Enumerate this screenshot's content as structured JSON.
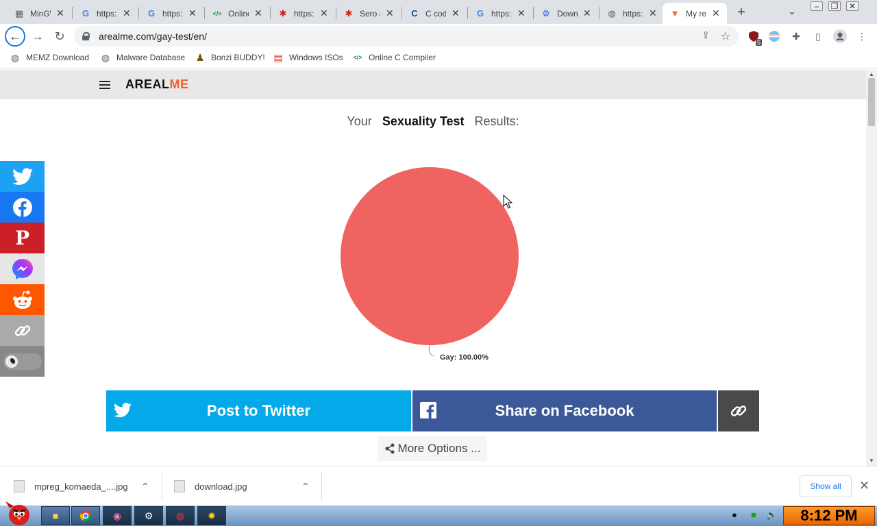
{
  "browser": {
    "tabs": [
      {
        "title": "MinGW",
        "icon": "grid-icon",
        "color": "#5f6368"
      },
      {
        "title": "https:",
        "icon": "google-icon",
        "color": "#4285f4"
      },
      {
        "title": "https:",
        "icon": "google-icon",
        "color": "#4285f4"
      },
      {
        "title": "Online",
        "icon": "code-icon",
        "color": "#1e8e3e"
      },
      {
        "title": "https:",
        "icon": "bug-icon",
        "color": "#c5221f"
      },
      {
        "title": "Sero a",
        "icon": "bug-icon",
        "color": "#c5221f"
      },
      {
        "title": "C code",
        "icon": "c-icon",
        "color": "#1a4b8c"
      },
      {
        "title": "https:",
        "icon": "google-icon",
        "color": "#4285f4"
      },
      {
        "title": "Down",
        "icon": "gear-icon",
        "color": "#1a73e8"
      },
      {
        "title": "https:",
        "icon": "globe-icon",
        "color": "#5f6368"
      },
      {
        "title": "My re",
        "icon": "fox-icon",
        "color": "#f0612d"
      }
    ],
    "url": "arealme.com/gay-test/en/",
    "extension_badge": "5",
    "bookmarks": [
      {
        "label": "MEMZ Download",
        "icon": "globe-icon"
      },
      {
        "label": "Malware Database",
        "icon": "globe-icon"
      },
      {
        "label": "Bonzi BUDDY!",
        "icon": "bonzi-icon"
      },
      {
        "label": "Windows ISOs",
        "icon": "windows-icon"
      },
      {
        "label": "Online C Compiler",
        "icon": "code-icon"
      }
    ]
  },
  "site": {
    "logo_main": "AREAL",
    "logo_accent": "ME",
    "accent_color": "#f0612d",
    "results_prefix": "Your",
    "results_title": "Sexuality Test",
    "results_suffix": "Results:"
  },
  "chart_data": {
    "type": "pie",
    "slices": [
      {
        "label": "Gay",
        "value": 100.0,
        "color": "#ef6461"
      }
    ],
    "data_labels": [
      "Gay: 100.00%"
    ]
  },
  "share_sidebar": [
    {
      "name": "twitter",
      "color": "#1da1f2"
    },
    {
      "name": "facebook",
      "color": "#1877f2"
    },
    {
      "name": "pinterest",
      "color": "#cb2027"
    },
    {
      "name": "messenger",
      "color": "#e6e6e6"
    },
    {
      "name": "reddit",
      "color": "#ff5700"
    },
    {
      "name": "link",
      "color": "#aaaaaa"
    },
    {
      "name": "dark-mode",
      "color": "#888888"
    }
  ],
  "buttons": {
    "twitter": "Post to Twitter",
    "facebook": "Share on Facebook",
    "more": "More Options ..."
  },
  "downloads": {
    "items": [
      "mpreg_komaeda_....jpg",
      "download.jpg"
    ],
    "show_all": "Show all"
  },
  "taskbar": {
    "time": "8:12 PM"
  }
}
